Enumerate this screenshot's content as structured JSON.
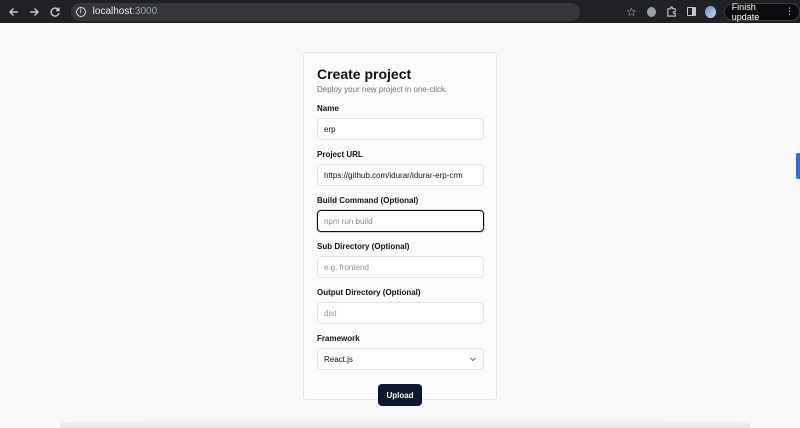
{
  "browser": {
    "url_host": "localhost",
    "url_port": ":3000",
    "finish_update_label": "Finish update"
  },
  "icons": {
    "back": "back-arrow-icon",
    "forward": "forward-arrow-icon",
    "reload": "reload-icon",
    "star": "star-icon",
    "extensions": "puzzle-icon",
    "menu": "kebab-menu-icon",
    "chevron": "chevron-down-icon"
  },
  "form": {
    "title": "Create project",
    "subtitle": "Deploy your new project in one-click.",
    "fields": [
      {
        "label": "Name",
        "value": "erp",
        "placeholder": ""
      },
      {
        "label": "Project URL",
        "value": "https://github.com/idurar/idurar-erp-crm",
        "placeholder": ""
      },
      {
        "label": "Build Command (Optional)",
        "value": "",
        "placeholder": "npm run build"
      },
      {
        "label": "Sub Directory (Optional)",
        "value": "",
        "placeholder": "e.g. frontend"
      },
      {
        "label": "Output Directory (Optional)",
        "value": "",
        "placeholder": "dist"
      }
    ],
    "framework": {
      "label": "Framework",
      "selected": "React.js"
    },
    "upload_label": "Upload"
  },
  "colors": {
    "primary_button": "#0f172a",
    "focus_ring": "#111111",
    "scroll_indicator": "#2f6fd6"
  }
}
